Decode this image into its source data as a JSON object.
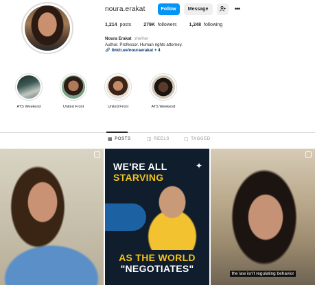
{
  "profile": {
    "username": "noura.erakat",
    "follow_label": "Follow",
    "message_label": "Message",
    "suggest_icon": "add-person-icon",
    "more_icon": "more-horizontal-icon"
  },
  "stats": {
    "posts_count": "1,214",
    "posts_label": "posts",
    "followers_count": "279K",
    "followers_label": "followers",
    "following_count": "1,248",
    "following_label": "following"
  },
  "bio": {
    "name": "Noura Erakat",
    "pronouns": "she/her",
    "description": "Author. Professor. Human rights attorney.",
    "link": "linktr.ee/nouraerakat + 4"
  },
  "highlights": [
    {
      "label": "ATS Weekend"
    },
    {
      "label": "United Front"
    },
    {
      "label": "United Front"
    },
    {
      "label": "ATS Weekend"
    }
  ],
  "tabs": [
    {
      "label": "POSTS",
      "icon": "grid-icon",
      "active": true
    },
    {
      "label": "REELS",
      "icon": "reels-icon",
      "active": false
    },
    {
      "label": "TAGGED",
      "icon": "tag-icon",
      "active": false
    }
  ],
  "posts": [
    {
      "type": "reel"
    },
    {
      "type": "image",
      "headline_line1": "WE'RE ALL",
      "headline_line2": "STARVING",
      "headline_line3": "AS THE WORLD",
      "headline_line4": "\"NEGOTIATES\""
    },
    {
      "type": "reel",
      "caption": "the law isn't regulating behavior"
    }
  ],
  "colors": {
    "follow_button": "#0095f6",
    "link": "#00376b",
    "post_accent_yellow": "#f4c21a"
  }
}
